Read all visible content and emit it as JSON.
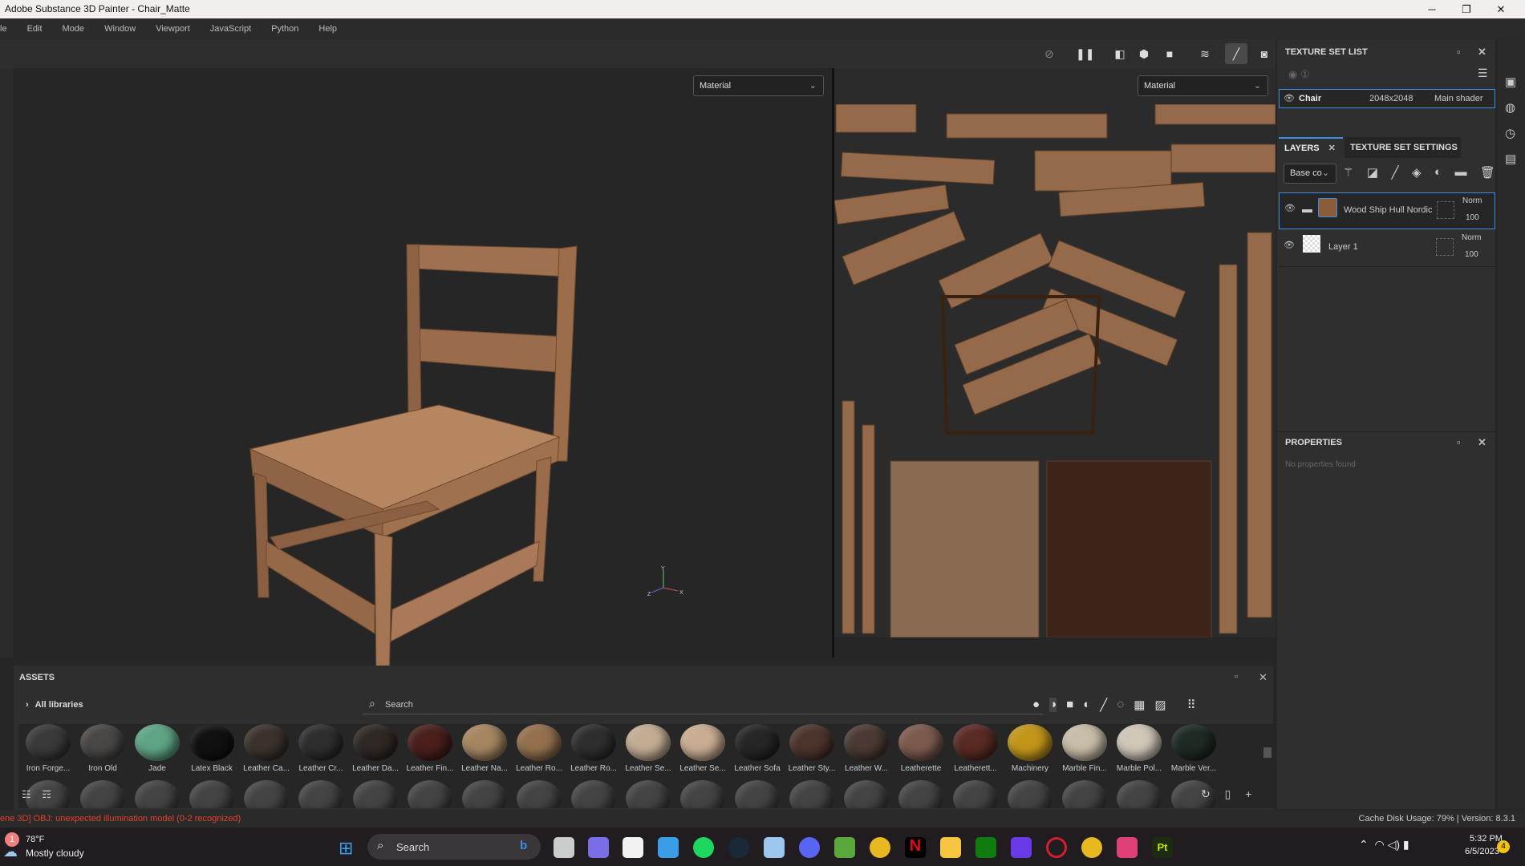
{
  "window": {
    "title": "Adobe Substance 3D Painter - Chair_Matte",
    "min": "─",
    "max": "❐",
    "close": "✕"
  },
  "menu": [
    "le",
    "Edit",
    "Mode",
    "Window",
    "Viewport",
    "JavaScript",
    "Python",
    "Help"
  ],
  "viewport": {
    "left_mode": "Material",
    "right_mode": "Material",
    "axis_y": "Y",
    "axis_x": "X",
    "axis_z": "Z"
  },
  "texture_set_list": {
    "title": "TEXTURE SET LIST",
    "row": {
      "name": "Chair",
      "resolution": "2048x2048",
      "shader": "Main shader"
    }
  },
  "layers": {
    "tab_layers": "LAYERS",
    "tab_settings": "TEXTURE SET SETTINGS",
    "channel": "Base co",
    "items": [
      {
        "name": "Wood Ship Hull Nordic",
        "blend": "Norm",
        "opacity": "100"
      },
      {
        "name": "Layer 1",
        "blend": "Norm",
        "opacity": "100"
      }
    ]
  },
  "properties": {
    "title": "PROPERTIES",
    "empty": "No properties found"
  },
  "assets": {
    "title": "ASSETS",
    "library": "All libraries",
    "search_placeholder": "Search",
    "items": [
      {
        "name": "Iron Forge...",
        "color": "#3a3a3a"
      },
      {
        "name": "Iron Old",
        "color": "#4a4746"
      },
      {
        "name": "Jade",
        "color": "#5fa585"
      },
      {
        "name": "Latex Black",
        "color": "#111"
      },
      {
        "name": "Leather Ca...",
        "color": "#3b322c"
      },
      {
        "name": "Leather Cr...",
        "color": "#2e2e2e"
      },
      {
        "name": "Leather Da...",
        "color": "#2f2825"
      },
      {
        "name": "Leather Fin...",
        "color": "#4a1f1c"
      },
      {
        "name": "Leather Na...",
        "color": "#a58660"
      },
      {
        "name": "Leather Ro...",
        "color": "#94704e"
      },
      {
        "name": "Leather Ro...",
        "color": "#2e2e2e"
      },
      {
        "name": "Leather Se...",
        "color": "#c3ac94"
      },
      {
        "name": "Leather Se...",
        "color": "#c9ad93"
      },
      {
        "name": "Leather Sofa",
        "color": "#262626"
      },
      {
        "name": "Leather Sty...",
        "color": "#4d352d"
      },
      {
        "name": "Leather W...",
        "color": "#4b3a33"
      },
      {
        "name": "Leatherette",
        "color": "#7d5a4e"
      },
      {
        "name": "Leatherett...",
        "color": "#5a2a24"
      },
      {
        "name": "Machinery",
        "color": "#c3961a"
      },
      {
        "name": "Marble Fin...",
        "color": "#c8bda8"
      },
      {
        "name": "Marble Pol...",
        "color": "#cfc7b8"
      },
      {
        "name": "Marble Ver...",
        "color": "#1f2a24"
      }
    ]
  },
  "status": {
    "error": "ene 3D] OBJ: unexpected illumination model (0-2 recognized)",
    "cache": "Cache Disk Usage:   79% | Version: 8.3.1"
  },
  "taskbar": {
    "temp": "78°F",
    "weather": "Mostly cloudy",
    "weather_badge": "1",
    "search": "Search",
    "time": "5:32 PM",
    "date": "6/5/2023",
    "notif": "4",
    "pt": "Pt"
  }
}
